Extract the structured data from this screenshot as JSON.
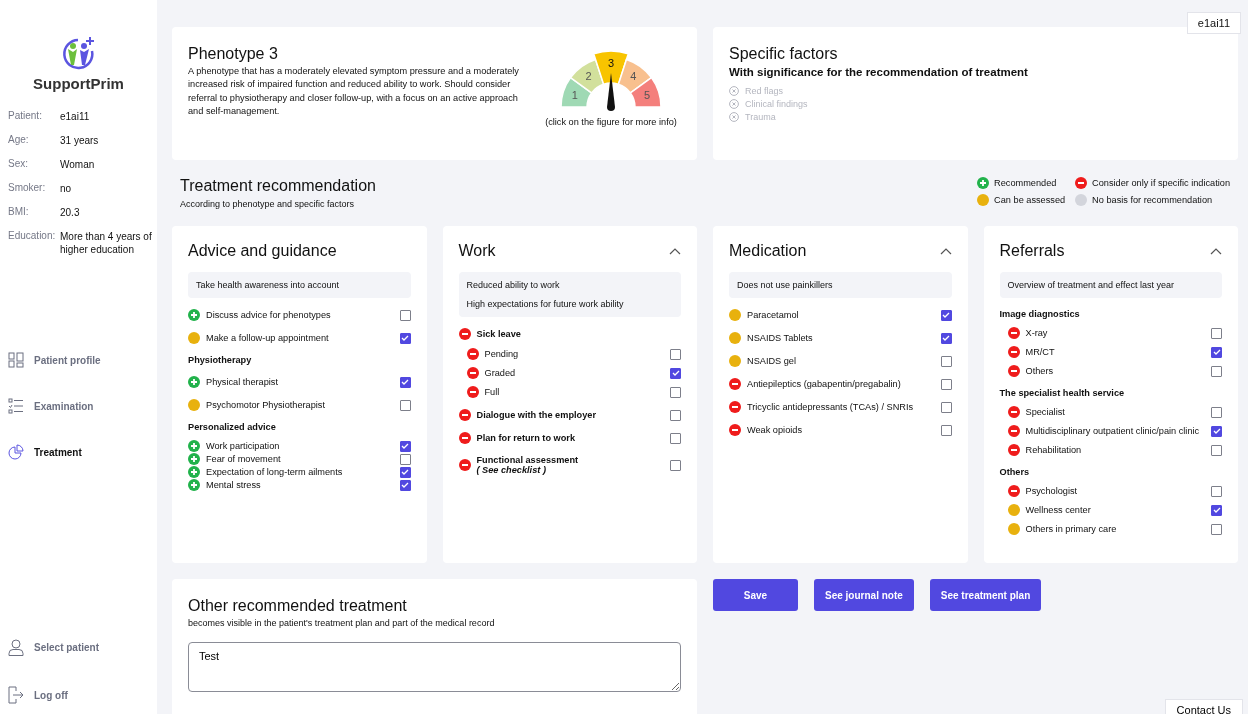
{
  "sidebar": {
    "logo": "SupportPrim",
    "patient": [
      {
        "label": "Patient:",
        "value": "e1ai11"
      },
      {
        "label": "Age:",
        "value": "31 years"
      },
      {
        "label": "Sex:",
        "value": "Woman"
      },
      {
        "label": "Smoker:",
        "value": "no"
      },
      {
        "label": "BMI:",
        "value": "20.3"
      },
      {
        "label": "Education:",
        "value": "More than 4 years of higher education"
      }
    ],
    "nav": [
      {
        "label": "Patient profile",
        "kind": "profile",
        "selected": false
      },
      {
        "label": "Examination",
        "kind": "checklist",
        "selected": false
      },
      {
        "label": "Treatment",
        "kind": "pie",
        "selected": true
      }
    ],
    "bottom": [
      {
        "label": "Select patient",
        "kind": "person"
      },
      {
        "label": "Log off",
        "kind": "logout"
      }
    ]
  },
  "user_badge": "e1ai11",
  "phenotype": {
    "title": "Phenotype 3",
    "description": "A phenotype that has a moderately elevated symptom pressure and a moderately increased risk of impaired function and reduced ability to work. Should consider referral to physiotherapy and closer follow-up, with a focus on an active approach and self-management.",
    "gauge": [
      {
        "label": "1",
        "color": "#9fd9b4",
        "selected": false
      },
      {
        "label": "2",
        "color": "#d2e09c",
        "selected": false
      },
      {
        "label": "3",
        "color": "#f8c400",
        "selected": true
      },
      {
        "label": "4",
        "color": "#f8c08e",
        "selected": false
      },
      {
        "label": "5",
        "color": "#f47f7c",
        "selected": false
      }
    ],
    "caption": "(click on the figure for more info)"
  },
  "specific_factors": {
    "title": "Specific factors",
    "subtitle": "With significance for the recommendation of treatment",
    "items": [
      {
        "label": "Red flags",
        "disabled": true
      },
      {
        "label": "Clinical findings",
        "disabled": true
      },
      {
        "label": "Trauma",
        "disabled": true
      }
    ]
  },
  "treatment": {
    "title": "Treatment recommendation",
    "subtitle": "According to phenotype and specific factors",
    "legend": [
      {
        "kind": "recommended",
        "label": "Recommended"
      },
      {
        "kind": "consider",
        "label": "Consider only if specific indication"
      },
      {
        "kind": "assess",
        "label": "Can be assessed"
      },
      {
        "kind": "none",
        "label": "No basis for recommendation"
      }
    ]
  },
  "cards": [
    {
      "title": "Advice and guidance",
      "expanded": false,
      "info": [
        "Take health awareness into account"
      ],
      "rows": [
        {
          "kind": "recommended",
          "label": "Discuss advice for phenotypes",
          "checked": false
        },
        {
          "kind": "assess",
          "label": "Make a follow-up appointment",
          "checked": true
        },
        {
          "kind": "heading",
          "label": "Physiotherapy"
        },
        {
          "kind": "recommended",
          "label": "Physical therapist",
          "checked": true
        },
        {
          "kind": "assess",
          "label": "Psychomotor Physiotherapist",
          "checked": false
        },
        {
          "kind": "heading",
          "label": "Personalized advice",
          "children": [
            {
              "kind": "recommended",
              "label": "Work participation",
              "checked": true
            },
            {
              "kind": "recommended",
              "label": "Fear of movement",
              "checked": false
            },
            {
              "kind": "recommended",
              "label": "Expectation of long-term ailments",
              "checked": true
            },
            {
              "kind": "recommended",
              "label": "Mental stress",
              "checked": true
            }
          ]
        }
      ]
    },
    {
      "title": "Work",
      "expanded": true,
      "info": [
        "Reduced ability to work",
        "High expectations for future work ability"
      ],
      "rows": [
        {
          "kind": "consider",
          "label": "Sick leave",
          "bold": true,
          "children": [
            {
              "kind": "consider",
              "label": "Pending",
              "checked": false
            },
            {
              "kind": "consider",
              "label": "Graded",
              "checked": true
            },
            {
              "kind": "consider",
              "label": "Full",
              "checked": false
            }
          ]
        },
        {
          "kind": "consider",
          "label": "Dialogue with the employer",
          "bold": true,
          "checked": false
        },
        {
          "kind": "consider",
          "label": "Plan for return to work",
          "bold": true,
          "checked": false
        },
        {
          "kind": "consider",
          "label": "Functional assessment",
          "bold": true,
          "note": "( See checklist )",
          "checked": false
        }
      ]
    },
    {
      "title": "Medication",
      "expanded": true,
      "info": [
        "Does not use painkillers"
      ],
      "rows": [
        {
          "kind": "assess",
          "label": "Paracetamol",
          "checked": true
        },
        {
          "kind": "assess",
          "label": "NSAIDS Tablets",
          "checked": true
        },
        {
          "kind": "assess",
          "label": "NSAIDS gel",
          "checked": false
        },
        {
          "kind": "consider",
          "label": "Antiepileptics (gabapentin/pregabalin)",
          "checked": false
        },
        {
          "kind": "consider",
          "label": "Tricyclic antidepressants (TCAs) / SNRIs",
          "checked": false
        },
        {
          "kind": "consider",
          "label": "Weak opioids",
          "checked": false
        }
      ]
    },
    {
      "title": "Referrals",
      "expanded": true,
      "info": [
        "Overview of treatment and effect last year"
      ],
      "rows": [
        {
          "kind": "heading",
          "label": "Image diagnostics",
          "children": [
            {
              "kind": "consider",
              "label": "X-ray",
              "checked": false
            },
            {
              "kind": "consider",
              "label": "MR/CT",
              "checked": true
            },
            {
              "kind": "consider",
              "label": "Others",
              "checked": false
            }
          ]
        },
        {
          "kind": "heading",
          "label": "The specialist health service",
          "children": [
            {
              "kind": "consider",
              "label": "Specialist",
              "checked": false
            },
            {
              "kind": "consider",
              "label": "Multidisciplinary outpatient clinic/pain clinic",
              "checked": true
            },
            {
              "kind": "consider",
              "label": "Rehabilitation",
              "checked": false
            }
          ]
        },
        {
          "kind": "heading",
          "label": "Others",
          "children": [
            {
              "kind": "consider",
              "label": "Psychologist",
              "checked": false
            },
            {
              "kind": "assess",
              "label": "Wellness center",
              "checked": true
            },
            {
              "kind": "assess",
              "label": "Others in primary care",
              "checked": false
            }
          ]
        }
      ]
    }
  ],
  "other_treatment": {
    "title": "Other recommended treatment",
    "subtitle": "becomes visible in the patient's treatment plan and part of the medical record",
    "value": "Test"
  },
  "buttons": [
    "Save",
    "See journal note",
    "See treatment plan"
  ],
  "contact": "Contact Us"
}
